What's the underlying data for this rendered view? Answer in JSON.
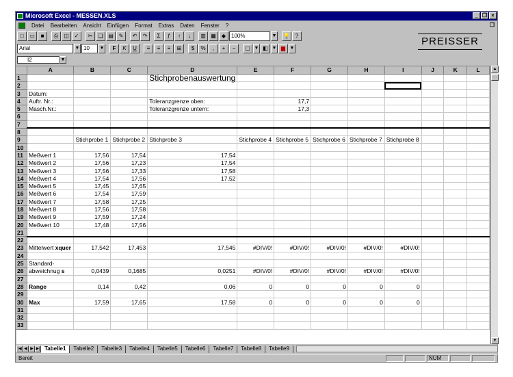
{
  "window": {
    "title": "Microsoft Excel - MESSEN.XLS"
  },
  "menu": [
    "Datei",
    "Bearbeiten",
    "Ansicht",
    "Einfügen",
    "Format",
    "Extras",
    "Daten",
    "Fenster",
    "?"
  ],
  "toolbar": {
    "zoom": "100%"
  },
  "format": {
    "font": "Arial",
    "size": "10"
  },
  "namebox": "I2",
  "logo": "PREISSER",
  "columns": [
    "A",
    "B",
    "C",
    "D",
    "E",
    "F",
    "G",
    "H",
    "I",
    "J",
    "K",
    "L"
  ],
  "cells": {
    "r1": {
      "title": "Stichprobenauswertung"
    },
    "r3": {
      "a": "Datum:"
    },
    "r4": {
      "a": "Auftr. Nr.:",
      "d": "Toleranzgrenze oben:",
      "f": "17,7"
    },
    "r5": {
      "a": "Masch.Nr.:",
      "d": "Toleranzgrenze untern:",
      "f": "17,3"
    },
    "r9": [
      "Stichprobe 1",
      "Stichprobe 2",
      "Stichprobe 3",
      "Stichprobe 4",
      "Stichprobe 5",
      "Stichprobe 6",
      "Stichprobe 7",
      "Stichprobe 8"
    ],
    "measure": [
      {
        "label": "Meßwert 1",
        "b": "17,56",
        "c": "17,54",
        "d": "17,54"
      },
      {
        "label": "Meßwert 2",
        "b": "17,56",
        "c": "17,23",
        "d": "17,54"
      },
      {
        "label": "Meßwert 3",
        "b": "17,56",
        "c": "17,33",
        "d": "17,58"
      },
      {
        "label": "Meßwert 4",
        "b": "17,54",
        "c": "17,56",
        "d": "17,52"
      },
      {
        "label": "Meßwert 5",
        "b": "17,45",
        "c": "17,65",
        "d": ""
      },
      {
        "label": "Meßwert 6",
        "b": "17,54",
        "c": "17,59",
        "d": ""
      },
      {
        "label": "Meßwert 7",
        "b": "17,58",
        "c": "17,25",
        "d": ""
      },
      {
        "label": "Meßwert 8",
        "b": "17,56",
        "c": "17,58",
        "d": ""
      },
      {
        "label": "Meßwert 9",
        "b": "17,59",
        "c": "17,24",
        "d": ""
      },
      {
        "label": "Meßwert 10",
        "b": "17,48",
        "c": "17,56",
        "d": ""
      }
    ],
    "r23": {
      "a": "Mittelwert",
      "a_bold": "xquer",
      "vals": [
        "17,542",
        "17,453",
        "17,545",
        "#DIV/0!",
        "#DIV/0!",
        "#DIV/0!",
        "#DIV/0!",
        "#DIV/0!"
      ]
    },
    "r25": {
      "a": "Standard-"
    },
    "r26": {
      "a": "abweichnug",
      "a_bold": "s",
      "vals": [
        "0,0439",
        "0,1685",
        "0,0251",
        "#DIV/0!",
        "#DIV/0!",
        "#DIV/0!",
        "#DIV/0!",
        "#DIV/0!"
      ]
    },
    "r28": {
      "a": "Range",
      "vals": [
        "0,14",
        "0,42",
        "0,06",
        "0",
        "0",
        "0",
        "0",
        "0"
      ]
    },
    "r30": {
      "a": "Max",
      "vals": [
        "17,59",
        "17,65",
        "17,58",
        "0",
        "0",
        "0",
        "0",
        "0"
      ]
    }
  },
  "tabs": [
    "Tabelle1",
    "Tabelle2",
    "Tabelle3",
    "Tabelle4",
    "Tabelle5",
    "Tabelle6",
    "Tabelle7",
    "Tabelle8",
    "Tabelle9"
  ],
  "status": {
    "ready": "Bereit",
    "num": "NUM"
  }
}
